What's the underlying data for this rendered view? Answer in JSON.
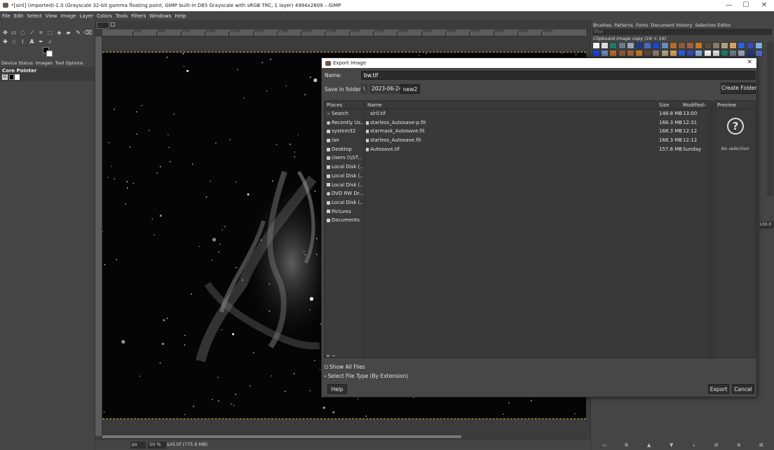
{
  "window": {
    "title": "*[siril] (imported)-1.0 (Grayscale 32-bit gamma floating point, GIMP built-in D65 Grayscale with sRGB TRC, 1 layer) 4994x2809 – GIMP",
    "minimize": "—",
    "maximize": "☐",
    "close": "✕"
  },
  "menu": [
    "File",
    "Edit",
    "Select",
    "View",
    "Image",
    "Layer",
    "Colors",
    "Tools",
    "Filters",
    "Windows",
    "Help"
  ],
  "left_dock": {
    "tabs": [
      "Device Status",
      "Images",
      "Tool Options"
    ],
    "device_label": "Core Pointer",
    "device_key": "G"
  },
  "right_dock": {
    "tabs": [
      "Brushes",
      "Patterns",
      "Fonts",
      "Document History",
      "Selection Editor"
    ],
    "filter_placeholder": "filter",
    "brush_name": "Clipboard Image copy (16 × 16)",
    "zoom_value": "100.0"
  },
  "ruler_ticks": [
    "250",
    "500",
    "750",
    "1000",
    "1250",
    "1500",
    "1750",
    "2000",
    "2250",
    "2500",
    "2750",
    "3000",
    "3250",
    "3500",
    "3750",
    "4000",
    "4250",
    "4500"
  ],
  "status": {
    "unit": "px",
    "zoom": "50 %",
    "file_info": "siril.tif (775.9 MB)"
  },
  "dialog": {
    "title": "Export Image",
    "name_label": "Name:",
    "name_value": "bw.tif",
    "save_in_label": "Save in folder:",
    "crumbs": [
      "\\",
      "2023-06-24",
      "new2"
    ],
    "create_folder": "Create Folder",
    "places_header": "Places",
    "places": [
      "Search",
      "Recently Us...",
      "system32",
      "ian",
      "Desktop",
      "Users (\\\\ST...",
      "Local Disk (...",
      "Local Disk (...",
      "Local Disk (...",
      "DVD RW Dr...",
      "Local Disk (...",
      "Pictures",
      "Documents"
    ],
    "places_add": "+  −",
    "columns": {
      "name": "Name",
      "size": "Size",
      "modified": "Modified"
    },
    "files": [
      {
        "name": "siril.tif",
        "size": "148.8 MB",
        "modified": "13:00"
      },
      {
        "name": "starless_Autosave-p.fit",
        "size": "168.3 MB",
        "modified": "12:31"
      },
      {
        "name": "starmask_Autosave.fit",
        "size": "168.3 MB",
        "modified": "12:12"
      },
      {
        "name": "starless_Autosave.fit",
        "size": "168.3 MB",
        "modified": "12:12"
      },
      {
        "name": "Autosave.tif",
        "size": "157.6 MB",
        "modified": "Sunday"
      }
    ],
    "preview_header": "Preview",
    "preview_icon": "?",
    "no_selection": "No selection",
    "show_all_files": "Show All Files",
    "select_file_type": "Select File Type (By Extension)",
    "help": "Help",
    "export": "Export",
    "cancel": "Cancel"
  }
}
